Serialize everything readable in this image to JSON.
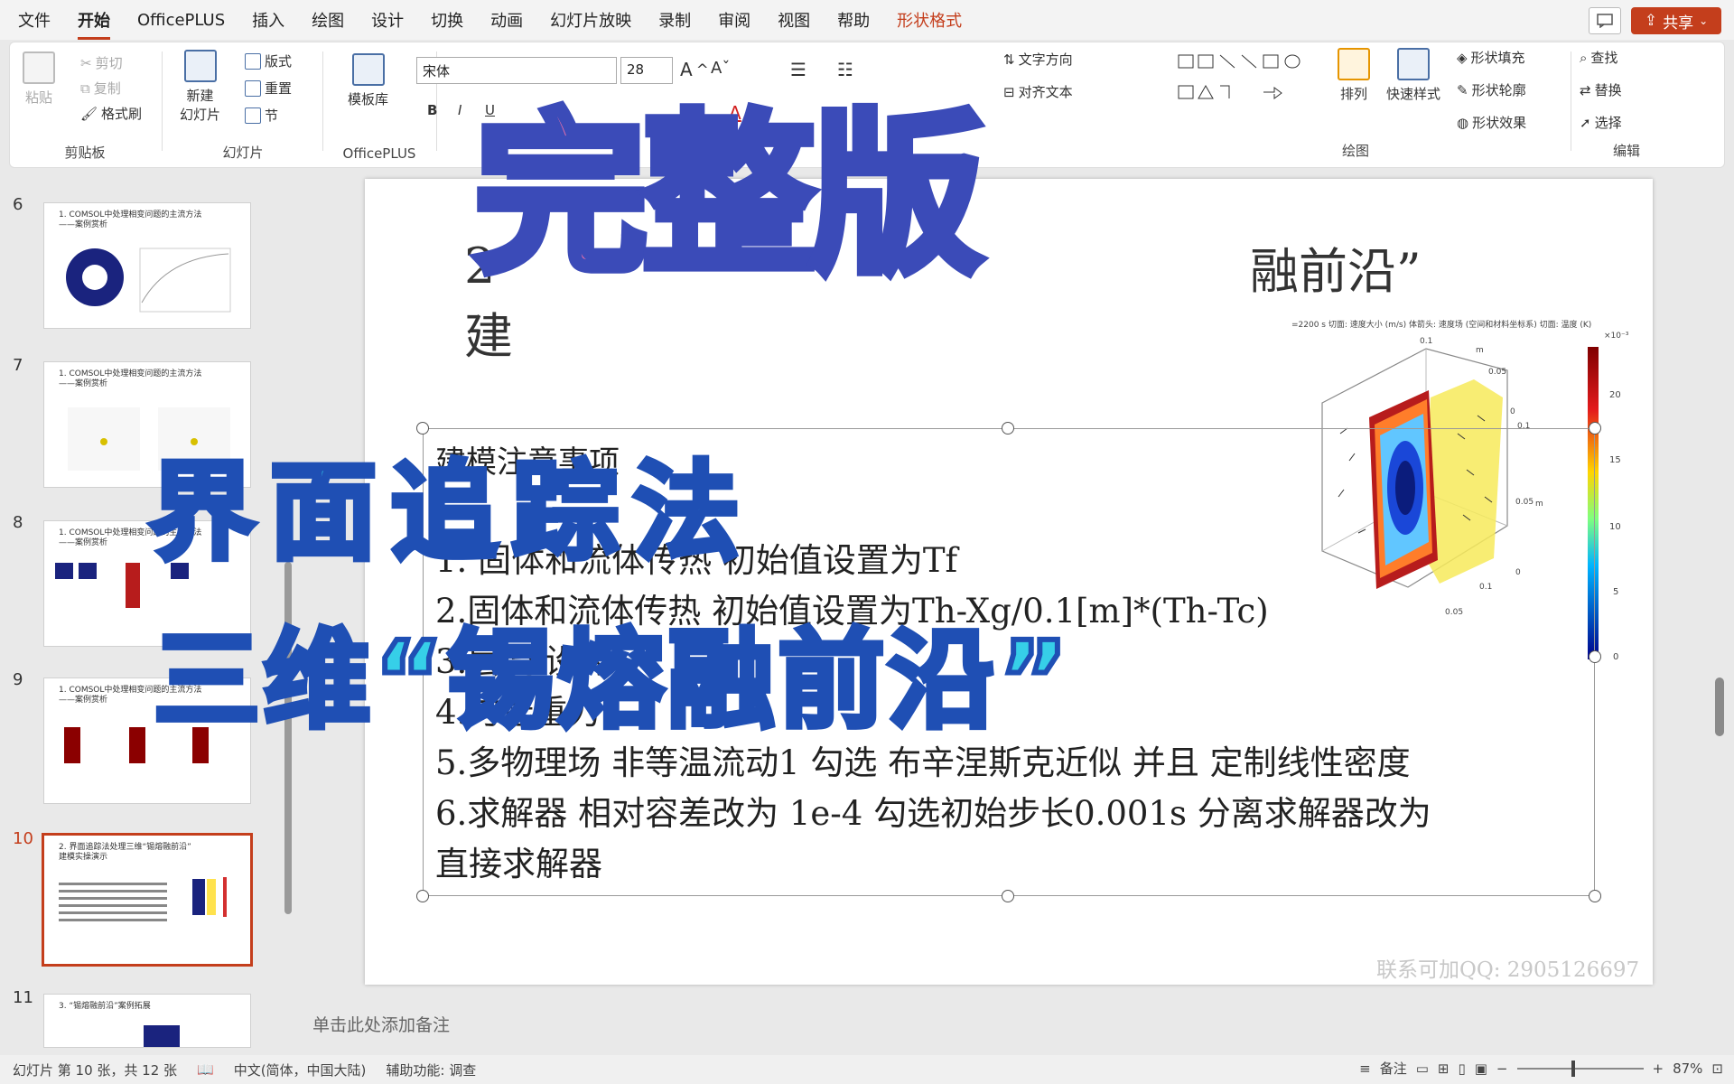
{
  "menu": {
    "tabs": [
      "文件",
      "开始",
      "OfficePLUS",
      "插入",
      "绘图",
      "设计",
      "切换",
      "动画",
      "幻灯片放映",
      "录制",
      "审阅",
      "视图",
      "帮助",
      "形状格式"
    ],
    "share_label": "共享"
  },
  "ribbon": {
    "clipboard": {
      "paste": "粘贴",
      "cut": "剪切",
      "copy": "复制",
      "format_painter": "格式刷",
      "label": "剪贴板"
    },
    "slides": {
      "new_slide": "新建\n幻灯片",
      "layout": "版式",
      "reset": "重置",
      "section": "节",
      "label": "幻灯片"
    },
    "officeplus": {
      "template_library": "模板库",
      "label": "OfficePLUS"
    },
    "font": {
      "font_name": "宋体",
      "font_size": "28"
    },
    "paragraph": {
      "text_direction": "文字方向",
      "align_text": "对齐文本"
    },
    "drawing": {
      "arrange": "排列",
      "quick_styles": "快速样式",
      "shape_fill": "形状填充",
      "shape_outline": "形状轮廓",
      "shape_effects": "形状效果",
      "label": "绘图"
    },
    "editing": {
      "find": "查找",
      "replace": "替换",
      "select": "选择",
      "label": "编辑"
    }
  },
  "thumbnails": [
    {
      "num": "6",
      "title": "1. COMSOL中处理相变问题的主流方法\n——案例赏析"
    },
    {
      "num": "7",
      "title": "1. COMSOL中处理相变问题的主流方法\n——案例赏析"
    },
    {
      "num": "8",
      "title": "1. COMSOL中处理相变问题的主流方法\n——案例赏析"
    },
    {
      "num": "9",
      "title": "1. COMSOL中处理相变问题的主流方法\n——案例赏析"
    },
    {
      "num": "10",
      "title": "2. 界面追踪法处理三维“锡熔融前沿”\n建模实操演示"
    },
    {
      "num": "11",
      "title": "3. “锡熔融前沿”案例拓展"
    }
  ],
  "slide": {
    "title_left": "2\n建",
    "title_right": "融前沿”",
    "notes_heading": "建模注意事项",
    "lines": [
      "1. 固体和流体传热 初始值设置为Tf",
      "2.固体和流体传热 初始值设置为Th-Xg/0.1[m]*(Th-Tc)",
      "3.层流 设为",
      "4.勾选重力",
      "5.多物理场 非等温流动1 勾选 布辛涅斯克近似 并且 定制线性密度",
      "6.求解器 相对容差改为 1e-4 勾选初始步长0.001s 分离求解器改为",
      "直接求解器"
    ],
    "contact": "联系可加QQ: 2905126697",
    "plot": {
      "header": "=2200 s  切面: 速度大小 (m/s)  体箭头: 速度场 (空间和材料坐标系)  切面: 温度 (K)",
      "colorbar_exp": "×10⁻³",
      "colorbar_ticks": [
        "20",
        "15",
        "10",
        "5",
        "0"
      ],
      "axis_ticks": [
        "0.1",
        "m",
        "0.05",
        "0",
        "0.1",
        "0.05",
        "m",
        "0",
        "0.1",
        "0.05"
      ]
    }
  },
  "notes_placeholder": "单击此处添加备注",
  "overlay": {
    "main": "完整版",
    "sub1": "界面追踪法",
    "sub2": "三维“锡熔融前沿”"
  },
  "status": {
    "slide_info": "幻灯片 第 10 张，共 12 张",
    "language": "中文(简体，中国大陆)",
    "accessibility": "辅助功能: 调查",
    "notes": "备注",
    "zoom": "87%"
  },
  "colors": {
    "accent": "#c43e1c",
    "overlay_pink": "#f472a8",
    "overlay_cyan": "#36cfe8",
    "overlay_outline": "#3b4bb8"
  }
}
